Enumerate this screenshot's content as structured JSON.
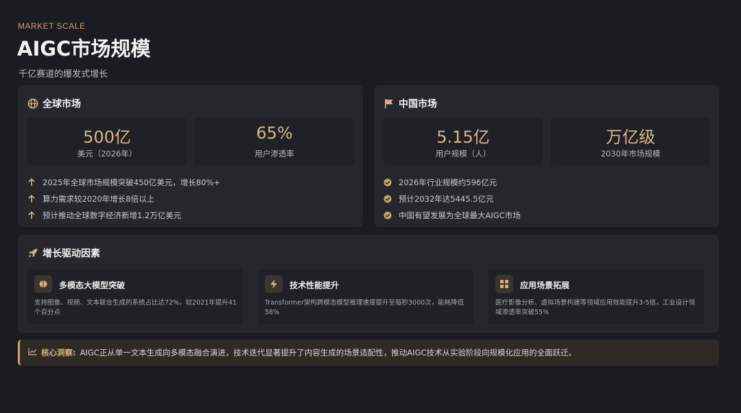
{
  "header": {
    "eyebrow": "MARKET SCALE",
    "title": "AIGC市场规模",
    "subtitle": "千亿赛道的爆发式增长"
  },
  "global_market": {
    "title": "全球市场",
    "icon": "globe-icon",
    "stats": [
      {
        "value": "500亿",
        "label": "美元（2026年）"
      },
      {
        "value": "65%",
        "label": "用户渗透率"
      }
    ],
    "bullets": [
      "2025年全球市场规模突破450亿美元，增长80%+",
      "算力需求较2020年增长8倍以上",
      "预计推动全球数字经济新增1.2万亿美元"
    ]
  },
  "china_market": {
    "title": "中国市场",
    "icon": "flag-icon",
    "stats": [
      {
        "value": "5.15亿",
        "label": "用户规模（人）"
      },
      {
        "value": "万亿级",
        "label": "2030年市场规模"
      }
    ],
    "bullets": [
      "2026年行业规模约596亿元",
      "预计2032年达5445.5亿元",
      "中国有望发展为全球最大AIGC市场"
    ]
  },
  "drivers": {
    "title": "增长驱动因素",
    "icon": "rocket-icon",
    "items": [
      {
        "title": "多模态大模型突破",
        "icon": "brain-icon",
        "desc": "支持图像、视频、文本联合生成的系统占比达72%，较2021年提升41个百分点"
      },
      {
        "title": "技术性能提升",
        "icon": "bolt-icon",
        "desc": "Transformer架构跨模态模型推理速度提升至每秒3000次，能耗降低58%"
      },
      {
        "title": "应用场景拓展",
        "icon": "grid-icon",
        "desc": "医疗影像分析、虚拟场景构建等领域应用效能提升3-5倍，工业设计领域渗透率突破55%"
      }
    ]
  },
  "insight": {
    "label": "核心洞察:",
    "text": "AIGC正从单一文本生成向多模态融合演进，技术迭代显著提升了内容生成的场景适配性，推动AIGC技术从实验阶段向规模化应用的全面跃迁。"
  },
  "colors": {
    "accent": "#c9a46a",
    "background": "#1a1c21",
    "card": "#25272c"
  }
}
